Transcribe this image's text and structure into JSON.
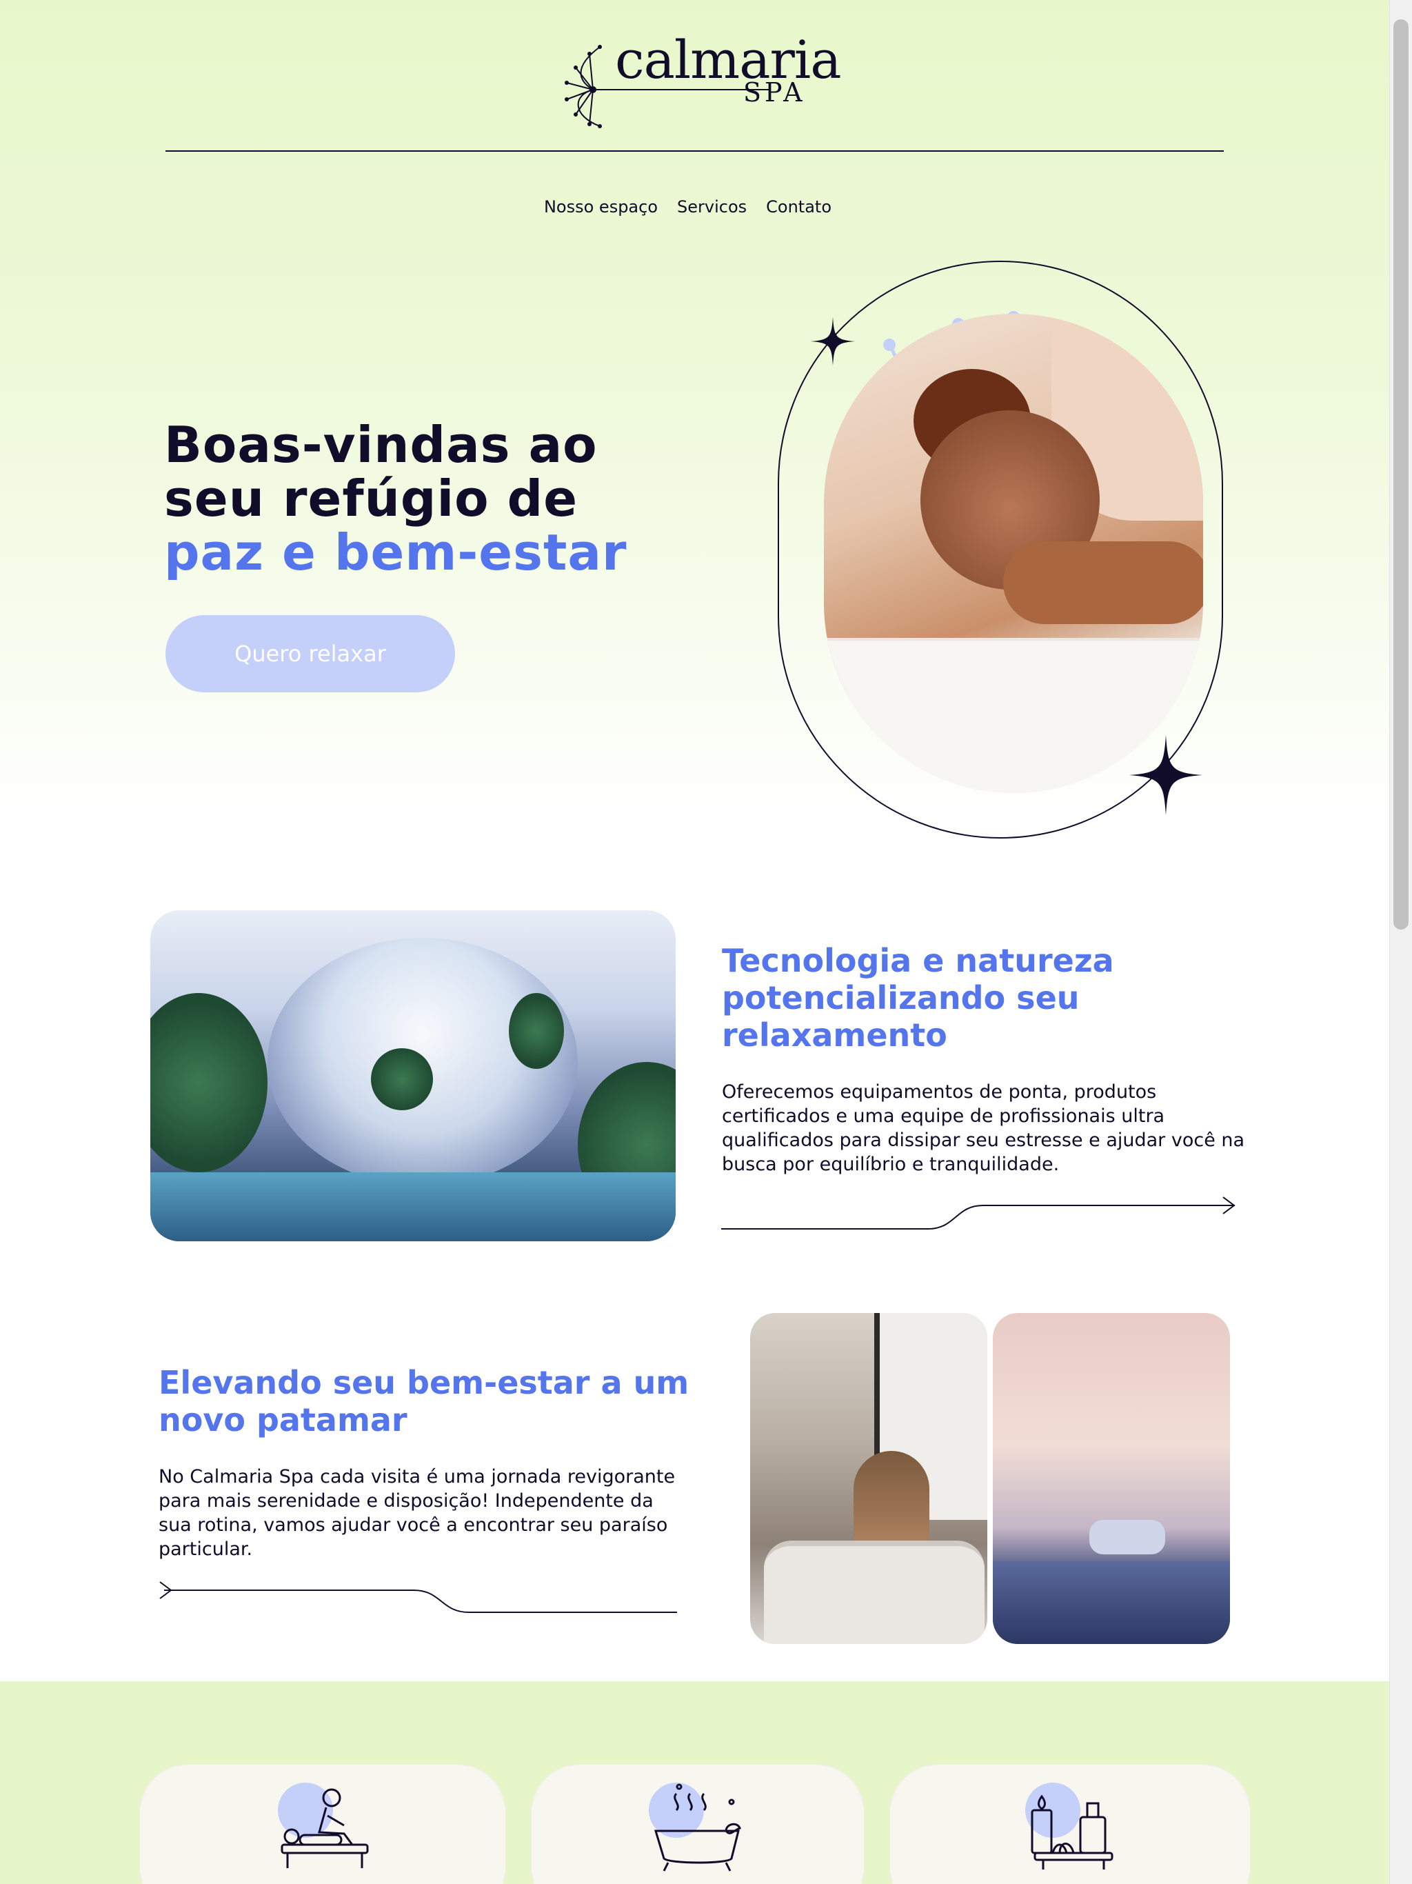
{
  "brand": {
    "name": "calmaria",
    "sub": "SPA"
  },
  "nav": {
    "items": [
      "Nosso espaço",
      "Servicos",
      "Contato"
    ]
  },
  "hero": {
    "title_line1": "Boas-vindas ao",
    "title_line2": "seu refúgio de",
    "title_accent": "paz e bem-estar",
    "cta": "Quero relaxar"
  },
  "section_tech": {
    "title": "Tecnologia e natureza potencializando seu relaxamento",
    "text": "Oferecemos equipamentos de ponta, produtos certificados e uma equipe de profissionais ultra qualificados para dissipar seu estresse e ajudar você na busca por equilíbrio e tranquilidade."
  },
  "section_wellbeing": {
    "title": "Elevando seu bem-estar a um novo patamar",
    "text": "No Calmaria Spa cada visita é uma jornada revigorante para mais serenidade e disposição! Independente da sua rotina, vamos ajudar você a encontrar seu paraíso particular."
  },
  "services": {
    "icons": [
      "massage-icon",
      "bath-icon",
      "aromatherapy-icon"
    ]
  },
  "colors": {
    "accent": "#5575ec",
    "dark": "#100c29",
    "lime_bg": "#e8f7cb",
    "lavender": "#c4cffa"
  }
}
